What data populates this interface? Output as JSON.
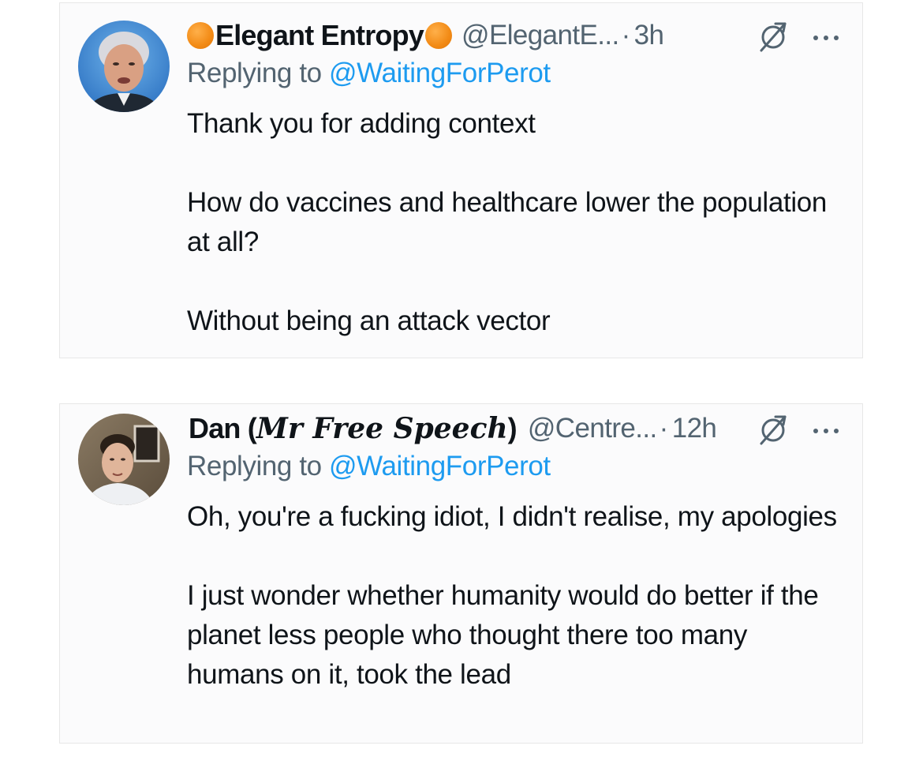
{
  "tweets": [
    {
      "display_name": "Elegant Entropy",
      "handle": "@ElegantE...",
      "separator": "·",
      "time": "3h",
      "replying_label": "Replying to ",
      "replying_to": "@WaitingForPerot",
      "paragraphs": [
        "Thank you for adding context",
        "How do vaccines and healthcare lower the population at all?",
        "Without being an attack vector"
      ],
      "icons": [
        "orange-circle-icon",
        "orange-circle-icon",
        "badge-icon",
        "more-icon"
      ]
    },
    {
      "display_name_plain": "Dan (",
      "display_name_gothic": "Mr Free Speech",
      "display_name_close": ")",
      "handle": "@Centre...",
      "separator": "·",
      "time": "12h",
      "replying_label": "Replying to ",
      "replying_to": "@WaitingForPerot",
      "paragraphs": [
        "Oh, you're a fucking idiot, I didn't realise, my apologies",
        "I just wonder whether humanity would do better if the planet less people who thought there too many humans on it, took the lead"
      ],
      "icons": [
        "badge-icon",
        "more-icon"
      ]
    }
  ],
  "colors": {
    "link": "#1d9bf0",
    "secondary_text": "#536471",
    "primary_text": "#0f1419",
    "card_background": "#fbfbfc"
  }
}
